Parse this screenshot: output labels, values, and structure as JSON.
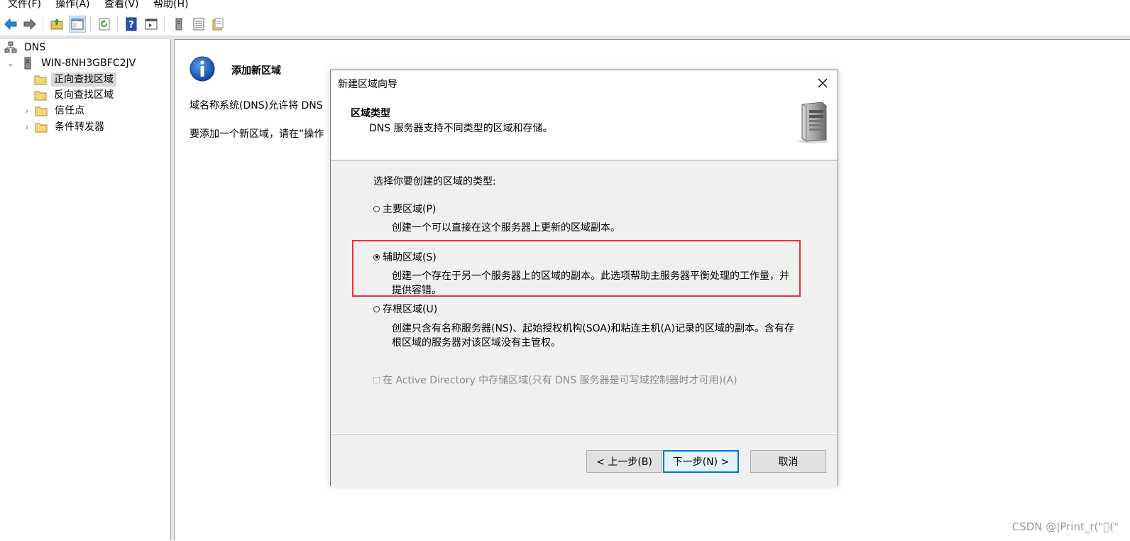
{
  "menu": {
    "file": "文件(F)",
    "action": "操作(A)",
    "view": "查看(V)",
    "help": "帮助(H)"
  },
  "toolbar_icons": [
    "back-arrow-icon",
    "forward-arrow-icon",
    "up-folder-icon",
    "show-hide-tree-icon",
    "refresh-icon",
    "help-icon",
    "console-view-icon",
    "server-icon",
    "list-icon",
    "properties-icon"
  ],
  "tree": {
    "root": "DNS",
    "server": "WIN-8NH3GBFC2JV",
    "forward_zones": "正向查找区域",
    "reverse_zones": "反向查找区域",
    "trust_points": "信任点",
    "conditional_forwarders": "条件转发器"
  },
  "content": {
    "title": "添加新区域",
    "p1": "域名称系统(DNS)允许将 DNS",
    "p2": "要添加一个新区域，请在“操作"
  },
  "dialog": {
    "title": "新建区域向导",
    "header_title": "区域类型",
    "header_subtitle": "DNS 服务器支持不同类型的区域和存储。",
    "prompt": "选择你要创建的区域的类型:",
    "options": [
      {
        "label": "主要区域(P)",
        "desc": "创建一个可以直接在这个服务器上更新的区域副本。",
        "selected": false
      },
      {
        "label": "辅助区域(S)",
        "desc": "创建一个存在于另一个服务器上的区域的副本。此选项帮助主服务器平衡处理的工作量，并提供容错。",
        "selected": true
      },
      {
        "label": "存根区域(U)",
        "desc": "创建只含有名称服务器(NS)、起始授权机构(SOA)和粘连主机(A)记录的区域的副本。含有存根区域的服务器对该区域没有主管权。",
        "selected": false
      }
    ],
    "ad_checkbox": "在 Active Directory 中存储区域(只有 DNS 服务器是可写域控制器时才可用)(A)",
    "back": "< 上一步(B)",
    "next": "下一步(N) >",
    "cancel": "取消"
  },
  "watermark": "CSDN @|Print_r(\"\u0000(\""
}
